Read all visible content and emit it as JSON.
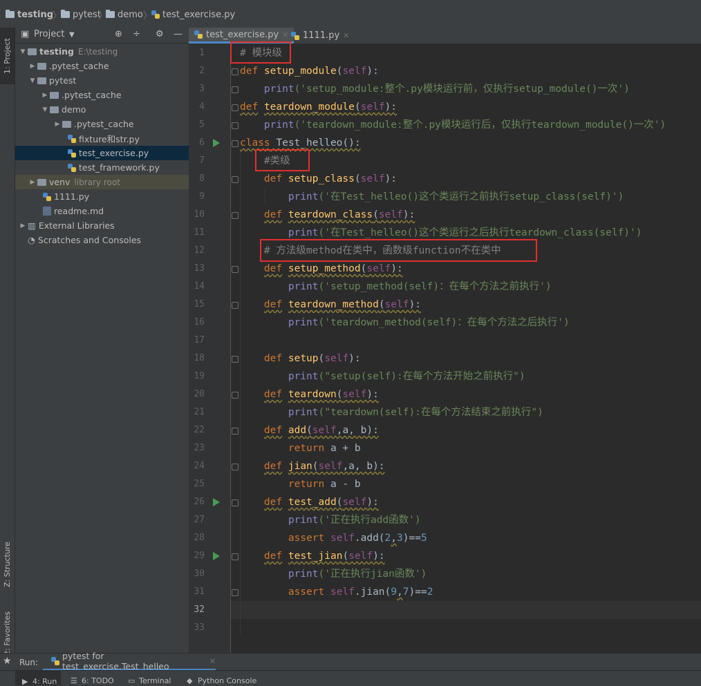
{
  "breadcrumb": [
    "testing",
    "pytest",
    "demo",
    "test_exercise.py"
  ],
  "project_panel": {
    "title": "Project",
    "tree": [
      {
        "label": "testing",
        "hint": "E:\\testing"
      },
      {
        "label": ".pytest_cache"
      },
      {
        "label": "pytest"
      },
      {
        "label": ".pytest_cache"
      },
      {
        "label": "demo"
      },
      {
        "label": ".pytest_cache"
      },
      {
        "label": "fixture和str.py"
      },
      {
        "label": "test_exercise.py"
      },
      {
        "label": "test_framework.py"
      },
      {
        "label": "venv",
        "hint": "library root"
      },
      {
        "label": "1111.py"
      },
      {
        "label": "readme.md"
      },
      {
        "label": "External Libraries"
      },
      {
        "label": "Scratches and Consoles"
      }
    ]
  },
  "side_tabs": {
    "project": "1: Project",
    "structure": "Z: Structure",
    "favorites": "2: Favorites"
  },
  "editor_tabs": [
    "test_exercise.py",
    "1111.py"
  ],
  "line_numbers": [
    "1",
    "2",
    "3",
    "4",
    "5",
    "6",
    "7",
    "8",
    "9",
    "10",
    "11",
    "12",
    "13",
    "14",
    "15",
    "16",
    "17",
    "18",
    "19",
    "20",
    "21",
    "22",
    "23",
    "24",
    "25",
    "26",
    "27",
    "28",
    "29",
    "30",
    "31",
    "32",
    "33"
  ],
  "code": {
    "l1": "# 模块级",
    "l2a": "def",
    "l2b": "setup_module",
    "l2c": "(",
    "l2d": "self",
    "l2e": "):",
    "l3a": "print",
    "l3b": "('setup_module:整个.py模块运行前，仅执行setup_module()一次')",
    "l4a": "def",
    "l4b": "teardown_module",
    "l4c": "(",
    "l4d": "self",
    "l4e": "):",
    "l5a": "print",
    "l5b": "('teardown_module:整个.py模块运行后，仅执行teardown_module()一次')",
    "l6a": "class",
    "l6b": " Test_helleo():",
    "l7": "#类级",
    "l8a": "def",
    "l8b": "setup_class",
    "l8c": "(",
    "l8d": "self",
    "l8e": "):",
    "l9a": "print",
    "l9b": "('在Test_helleo()这个类运行之前执行setup_class(self)')",
    "l10a": "def",
    "l10b": "teardown_class",
    "l10c": "(",
    "l10d": "self",
    "l10e": "):",
    "l11a": "print",
    "l11b": "('在Test_helleo()这个类运行之后执行teardown_class(self)')",
    "l12": "# 方法级method在类中，函数级function不在类中",
    "l13a": "def",
    "l13b": "setup_method",
    "l13c": "(",
    "l13d": "self",
    "l13e": "):",
    "l14a": "print",
    "l14b": "('setup_method(self)：在每个方法之前执行')",
    "l15a": "def",
    "l15b": "teardown_method",
    "l15c": "(",
    "l15d": "self",
    "l15e": "):",
    "l16a": "print",
    "l16b": "('teardown_method(self)：在每个方法之后执行')",
    "l18a": "def",
    "l18b": "setup",
    "l18c": "(",
    "l18d": "self",
    "l18e": "):",
    "l19a": "print",
    "l19b": "(\"setup(self):在每个方法开始之前执行\")",
    "l20a": "def",
    "l20b": "teardown",
    "l20c": "(",
    "l20d": "self",
    "l20e": "):",
    "l21a": "print",
    "l21b": "(\"teardown(self):在每个方法结束之前执行\")",
    "l22a": "def",
    "l22b": "add",
    "l22c": "(",
    "l22d": "self",
    "l22e": ",a, b):",
    "l23a": "return",
    "l23b": " a + b",
    "l24a": "def",
    "l24b": "jian",
    "l24c": "(",
    "l24d": "self",
    "l24e": ",a, b):",
    "l25a": "return",
    "l25b": " a - b",
    "l26a": "def",
    "l26b": "test_add",
    "l26c": "(",
    "l26d": "self",
    "l26e": "):",
    "l27a": "print",
    "l27b": "('正在执行add函数')",
    "l28a": "assert",
    "l28b": "self",
    "l28c": ".add(",
    "l28d": "2",
    "l28e": ",",
    "l28f": "3",
    "l28g": ")==",
    "l28h": "5",
    "l29a": "def",
    "l29b": "test_jian",
    "l29c": "(",
    "l29d": "self",
    "l29e": "):",
    "l30a": "print",
    "l30b": "('正在执行jian函数')",
    "l31a": "assert",
    "l31b": "self",
    "l31c": ".jian(",
    "l31d": "9",
    "l31e": ",",
    "l31f": "7",
    "l31g": ")==",
    "l31h": "2"
  },
  "run_bar": {
    "label": "Run:",
    "config": "pytest for test_exercise.Test_helleo"
  },
  "bottom_tabs": [
    "4: Run",
    "6: TODO",
    "Terminal",
    "Python Console"
  ],
  "colors": {
    "keyword": "#cc7832",
    "function": "#ffc66d",
    "self": "#94558d",
    "string": "#6a8759",
    "number": "#6897bb",
    "comment": "#808080",
    "highlight_box": "#e0302d"
  }
}
